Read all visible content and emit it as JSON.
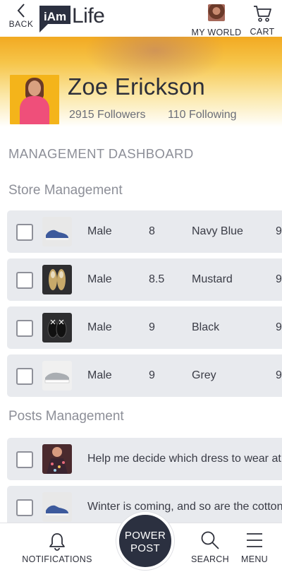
{
  "header": {
    "back_label": "BACK",
    "logo_badge": "iAm",
    "logo_text": "Life",
    "my_world_label": "MY WORLD",
    "cart_label": "CART"
  },
  "profile": {
    "name": "Zoe Erickson",
    "followers": "2915 Followers",
    "following": "110 Following"
  },
  "dashboard_title": "MANAGEMENT DASHBOARD",
  "store": {
    "title": "Store Management",
    "rows": [
      {
        "gender": "Male",
        "size": "8",
        "color": "Navy Blue",
        "extra": "9"
      },
      {
        "gender": "Male",
        "size": "8.5",
        "color": "Mustard",
        "extra": "9"
      },
      {
        "gender": "Male",
        "size": "9",
        "color": "Black",
        "extra": "9"
      },
      {
        "gender": "Male",
        "size": "9",
        "color": "Grey",
        "extra": "9"
      }
    ]
  },
  "posts": {
    "title": "Posts Management",
    "rows": [
      {
        "text": "Help me decide which dress to wear at"
      },
      {
        "text": "Winter is coming, and so are the cotton"
      }
    ]
  },
  "bottom_nav": {
    "notifications": "NOTIFICATIONS",
    "power_line1": "POWER",
    "power_line2": "POST",
    "search": "SEARCH",
    "menu": "MENU"
  }
}
